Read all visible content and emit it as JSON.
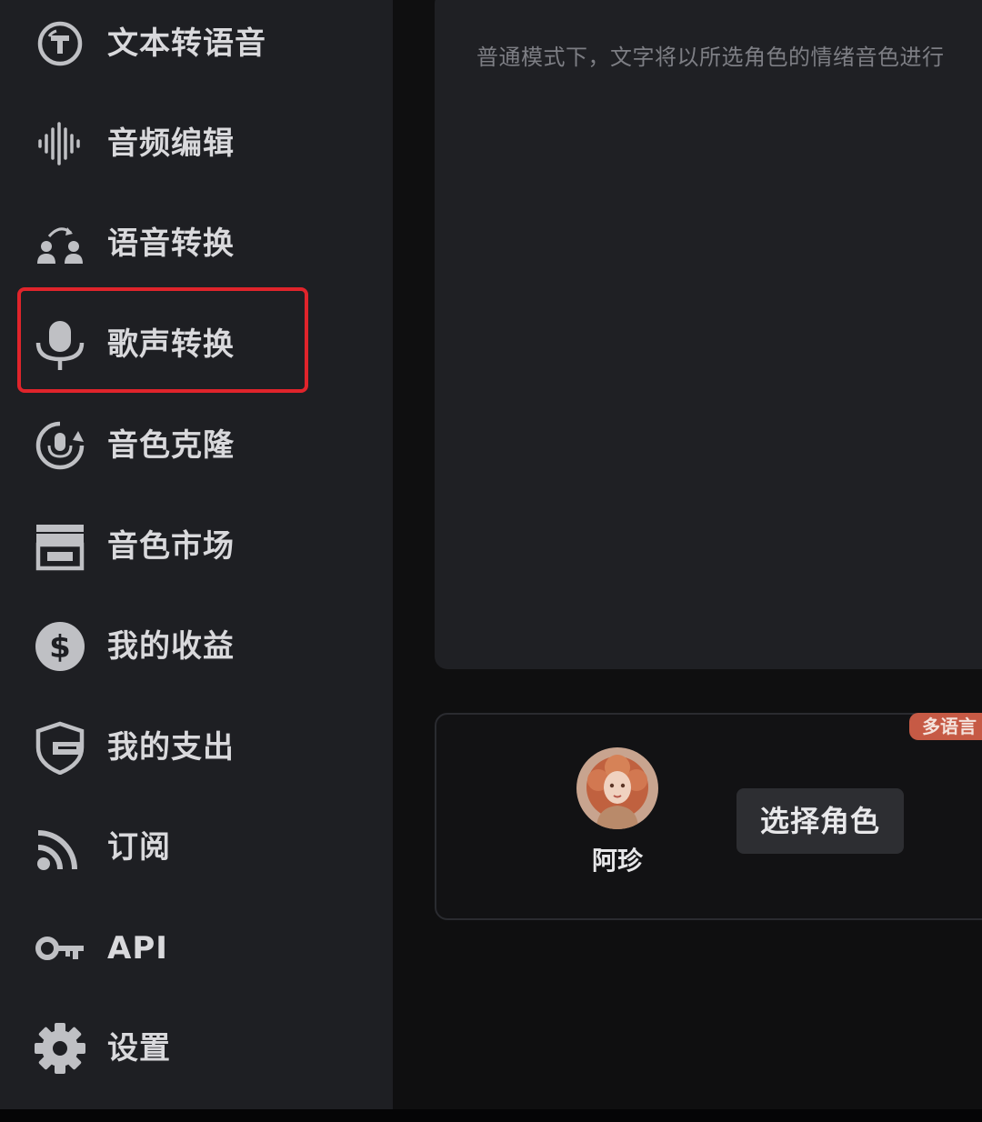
{
  "sidebar": {
    "items": [
      {
        "label": "文本转语音",
        "icon": "text-to-speech-icon"
      },
      {
        "label": "音频编辑",
        "icon": "audio-waveform-icon"
      },
      {
        "label": "语音转换",
        "icon": "voice-swap-icon"
      },
      {
        "label": "歌声转换",
        "icon": "microphone-icon",
        "highlighted": true
      },
      {
        "label": "音色克隆",
        "icon": "voice-clone-icon"
      },
      {
        "label": "音色市场",
        "icon": "store-icon"
      },
      {
        "label": "我的收益",
        "icon": "dollar-icon"
      },
      {
        "label": "我的支出",
        "icon": "wallet-shield-icon"
      },
      {
        "label": "订阅",
        "icon": "rss-icon"
      },
      {
        "label": "API",
        "icon": "key-icon"
      },
      {
        "label": "设置",
        "icon": "gear-icon"
      }
    ]
  },
  "main": {
    "text_placeholder": "普通模式下，文字将以所选角色的情绪音色进行",
    "badge": "多语言",
    "character": {
      "name": "阿珍"
    },
    "select_button": "选择角色"
  },
  "colors": {
    "sidebar_bg": "#1e1f23",
    "highlight_border": "#e0242b",
    "badge_bg": "#c65a45"
  }
}
